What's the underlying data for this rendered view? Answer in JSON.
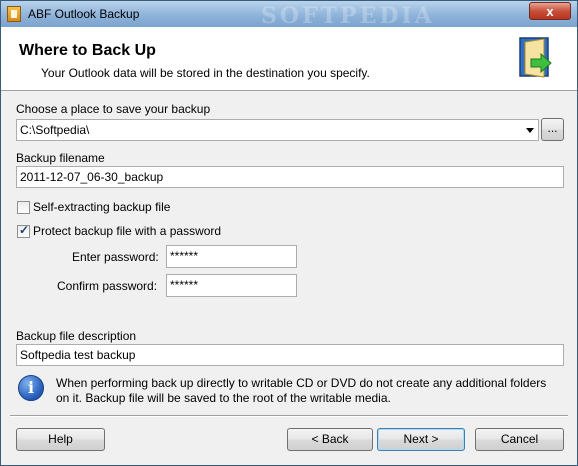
{
  "window": {
    "title": "ABF Outlook Backup",
    "watermark": "SOFTPEDIA",
    "close_label": "x"
  },
  "header": {
    "heading": "Where to Back Up",
    "subheading": "Your Outlook data will be stored in the destination you specify.",
    "icon": "wizard-door-arrow-icon"
  },
  "form": {
    "location_label": "Choose a place to save your backup",
    "location_value": "C:\\Softpedia\\",
    "browse_label": "...",
    "filename_label": "Backup filename",
    "filename_value": "2011-12-07_06-30_backup",
    "self_extracting_label": "Self-extracting backup file",
    "self_extracting_checked": false,
    "protect_label": "Protect backup file with a password",
    "protect_checked": true,
    "enter_password_label": "Enter password:",
    "enter_password_value": "******",
    "confirm_password_label": "Confirm password:",
    "confirm_password_value": "******",
    "description_label": "Backup file description",
    "description_value": "Softpedia test backup",
    "check_mark": "✓"
  },
  "info": {
    "icon": "info-icon",
    "icon_glyph": "i",
    "text": "When performing back up directly to writable CD or DVD do not create any additional folders on it. Backup file will be saved to the root of the writable media."
  },
  "footer": {
    "help_label": "Help",
    "back_label": "< Back",
    "next_label": "Next >",
    "cancel_label": "Cancel"
  }
}
